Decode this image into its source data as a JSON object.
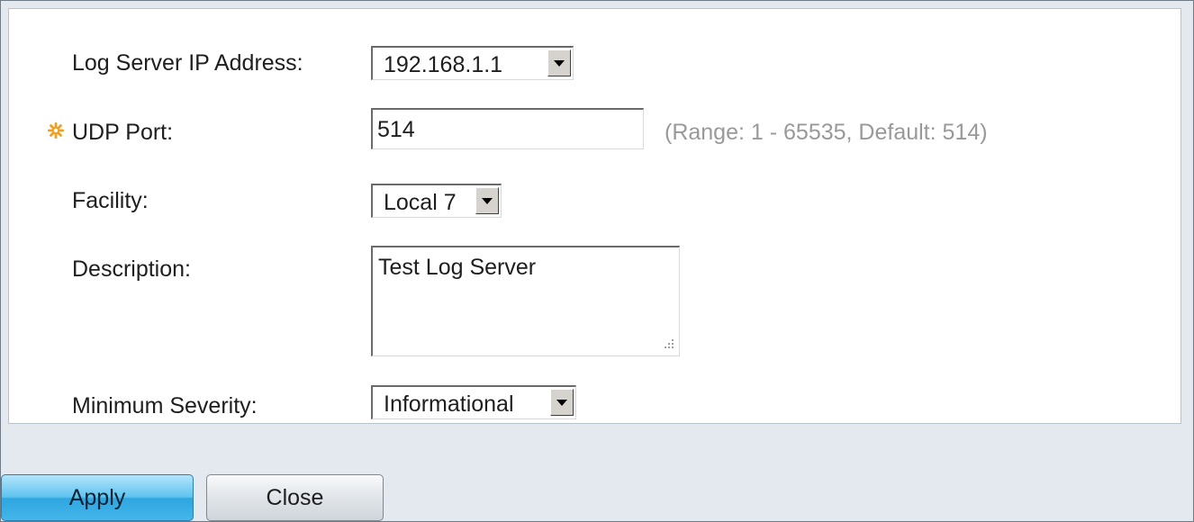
{
  "form": {
    "log_server_ip": {
      "label": "Log Server IP Address:",
      "value": "192.168.1.1"
    },
    "udp_port": {
      "label": "UDP Port:",
      "value": "514",
      "hint": "(Range: 1 - 65535, Default: 514)",
      "required_icon": "required-asterisk-icon"
    },
    "facility": {
      "label": "Facility:",
      "value": "Local 7"
    },
    "description": {
      "label": "Description:",
      "value": "Test Log Server"
    },
    "minimum_severity": {
      "label": "Minimum Severity:",
      "value": "Informational"
    }
  },
  "buttons": {
    "apply_label": "Apply",
    "close_label": "Close"
  },
  "colors": {
    "required_icon": "#f0a020",
    "hint_text": "#999999",
    "apply_button": "#44b6ea",
    "background": "#e3e9ef"
  }
}
